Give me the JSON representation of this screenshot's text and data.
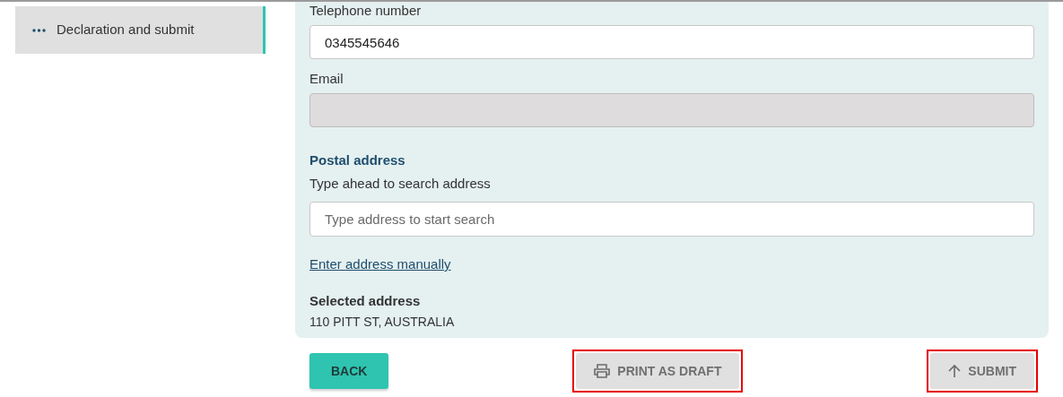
{
  "sidebar": {
    "items": [
      {
        "label": "Declaration and submit",
        "selected": true
      }
    ]
  },
  "contact": {
    "fields": [
      {
        "label": "Telephone number",
        "value": "0345545646",
        "disabled": false
      },
      {
        "label": "Email",
        "disabled": true
      }
    ]
  },
  "postal_address": {
    "heading": "Postal address",
    "hint": "Type ahead to search address",
    "placeholder": "Type address to start search",
    "link": "Enter address manually",
    "selected_label": "Selected address",
    "selected_value": "110 PITT ST, AUSTRALIA"
  },
  "buttons": [
    {
      "kind": "back",
      "label": "BACK",
      "highlighted": false
    },
    {
      "kind": "print",
      "label": "PRINT AS DRAFT",
      "highlighted": true
    },
    {
      "kind": "submit",
      "label": "SUBMIT",
      "highlighted": true
    }
  ]
}
